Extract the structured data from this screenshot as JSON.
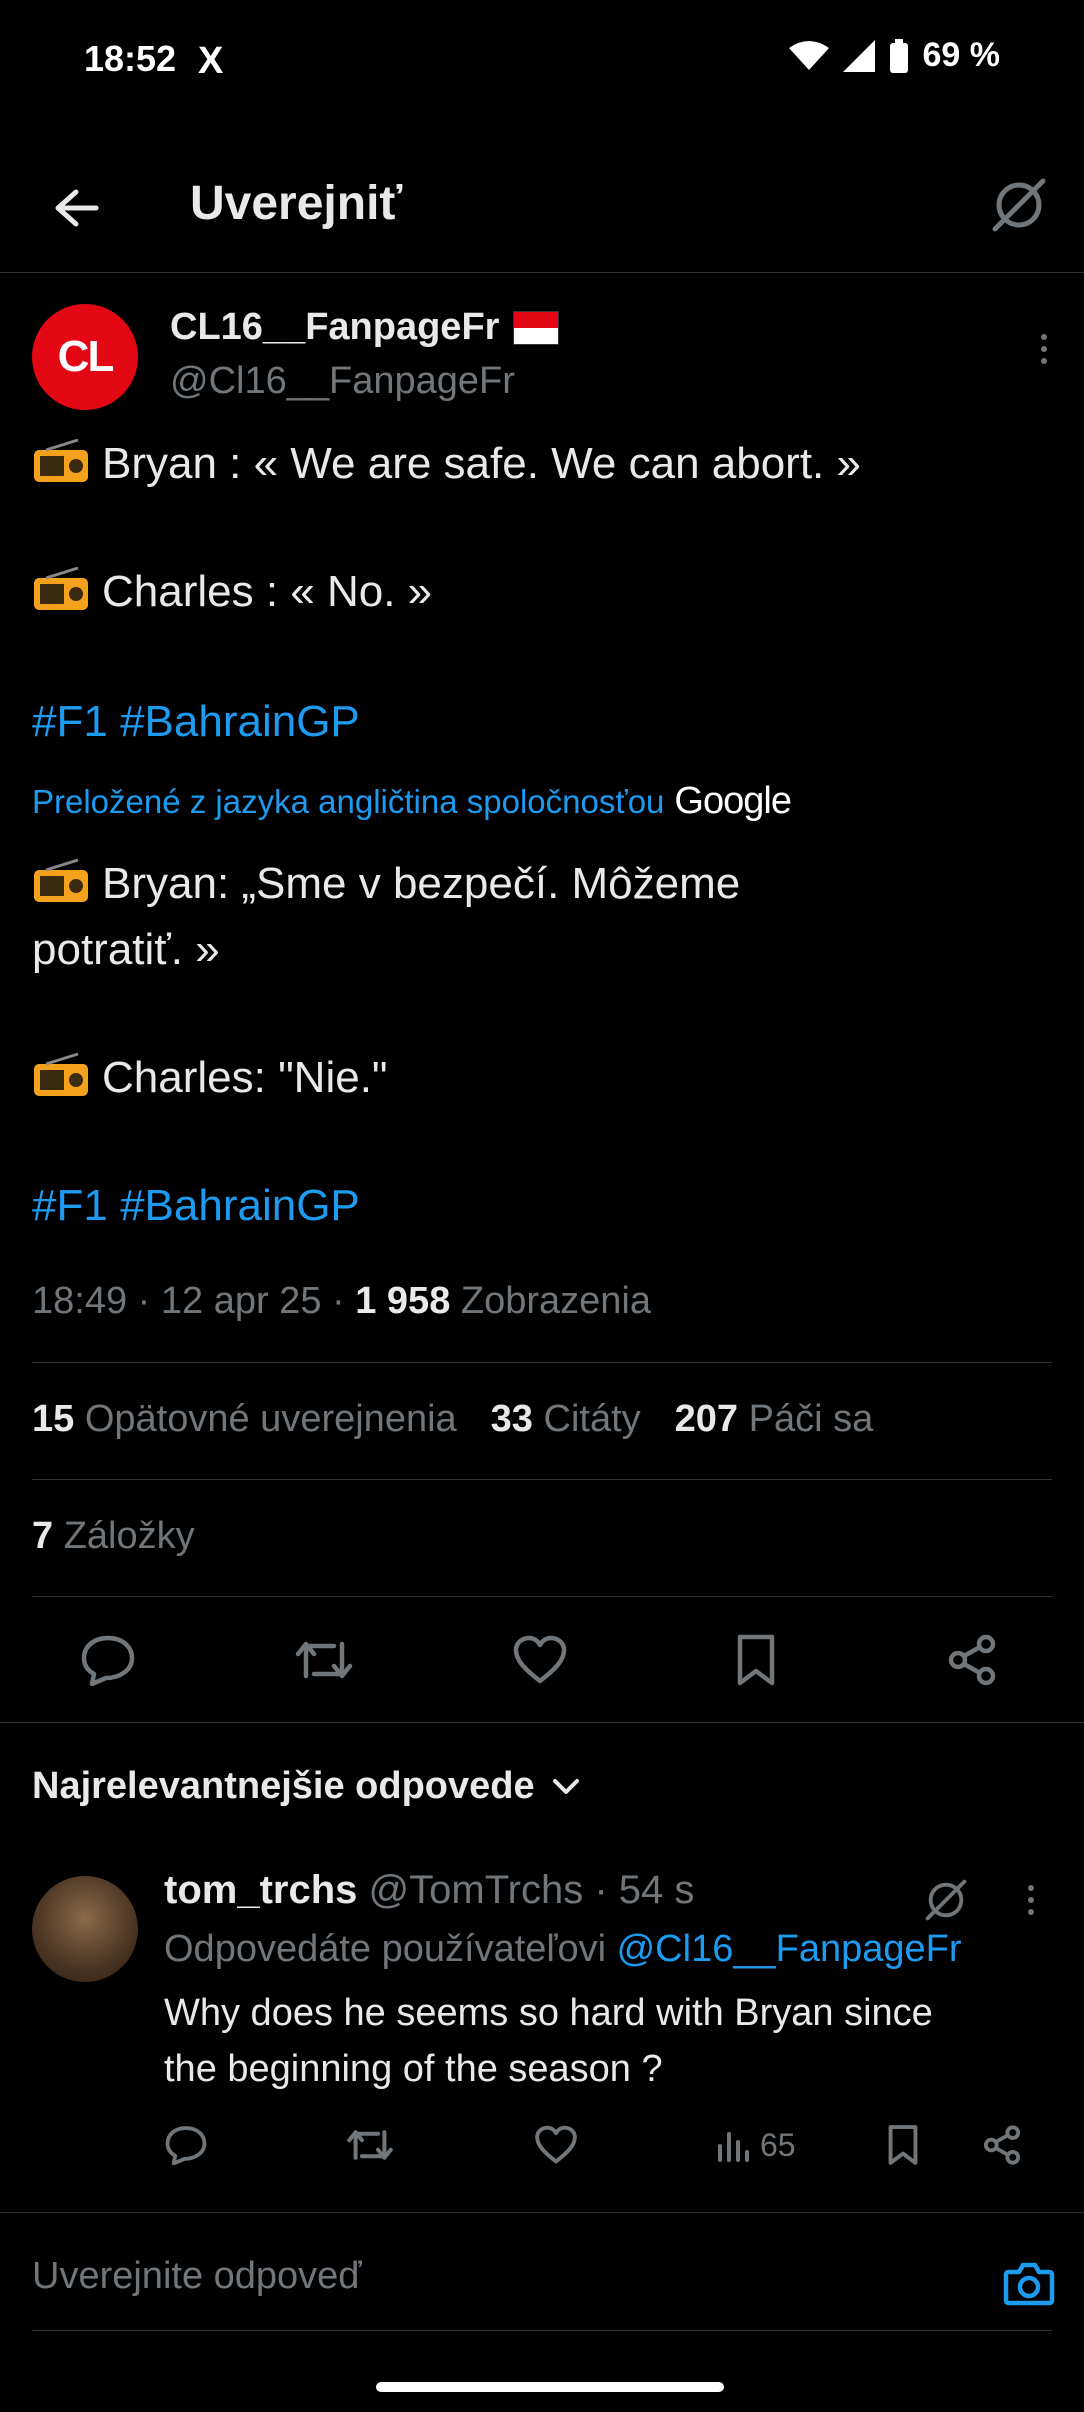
{
  "status_bar": {
    "time": "18:52",
    "x_logo": "X",
    "battery": "69 %"
  },
  "header": {
    "title": "Uverejniť"
  },
  "post": {
    "author_name": "CL16__FanpageFr",
    "author_handle": "@Cl16__FanpageFr",
    "avatar_text": "CL",
    "original_lines": [
      "Bryan : « We are safe. We can abort. »",
      "Charles : « No. »"
    ],
    "hashtags_original": [
      "#F1",
      "#BahrainGP"
    ],
    "translated_label": "Preložené z jazyka angličtina spoločnosťou",
    "translated_brand": "Google",
    "translated_line1a": "Bryan: „Sme v bezpečí. Môžeme",
    "translated_line1b": "potratiť. »",
    "translated_line2": "Charles: \"Nie.\"",
    "hashtags_translated": [
      "#F1",
      "#BahrainGP"
    ],
    "time": "18:49",
    "date": "12 apr 25",
    "views": "1 958",
    "views_label": "Zobrazenia"
  },
  "stats": {
    "reposts": "15",
    "reposts_label": "Opätovné uverejnenia",
    "quotes": "33",
    "quotes_label": "Citáty",
    "likes": "207",
    "likes_label": "Páči sa",
    "bookmarks": "7",
    "bookmarks_label": "Záložky"
  },
  "replies_sort": "Najrelevantnejšie odpovede",
  "reply": {
    "name": "tom_trchs",
    "handle": "@TomTrchs",
    "age": "54 s",
    "replying_to_label": "Odpovedáte používateľovi",
    "replying_to_handle": "@Cl16__FanpageFr",
    "line1": "Why does he seems so hard with Bryan since",
    "line2": "the beginning of the season ?",
    "views": "65"
  },
  "composer": {
    "placeholder": "Uverejnite odpoveď"
  },
  "colors": {
    "accent": "#1d9bf0",
    "background": "#000000",
    "muted": "#71767b",
    "divider": "#2f3336"
  },
  "icons": [
    "back-arrow-icon",
    "grok-icon",
    "radio-icon",
    "reply-icon",
    "repost-icon",
    "like-icon",
    "bookmark-icon",
    "share-icon",
    "views-icon",
    "camera-icon",
    "chevron-down-icon",
    "more-icon"
  ]
}
